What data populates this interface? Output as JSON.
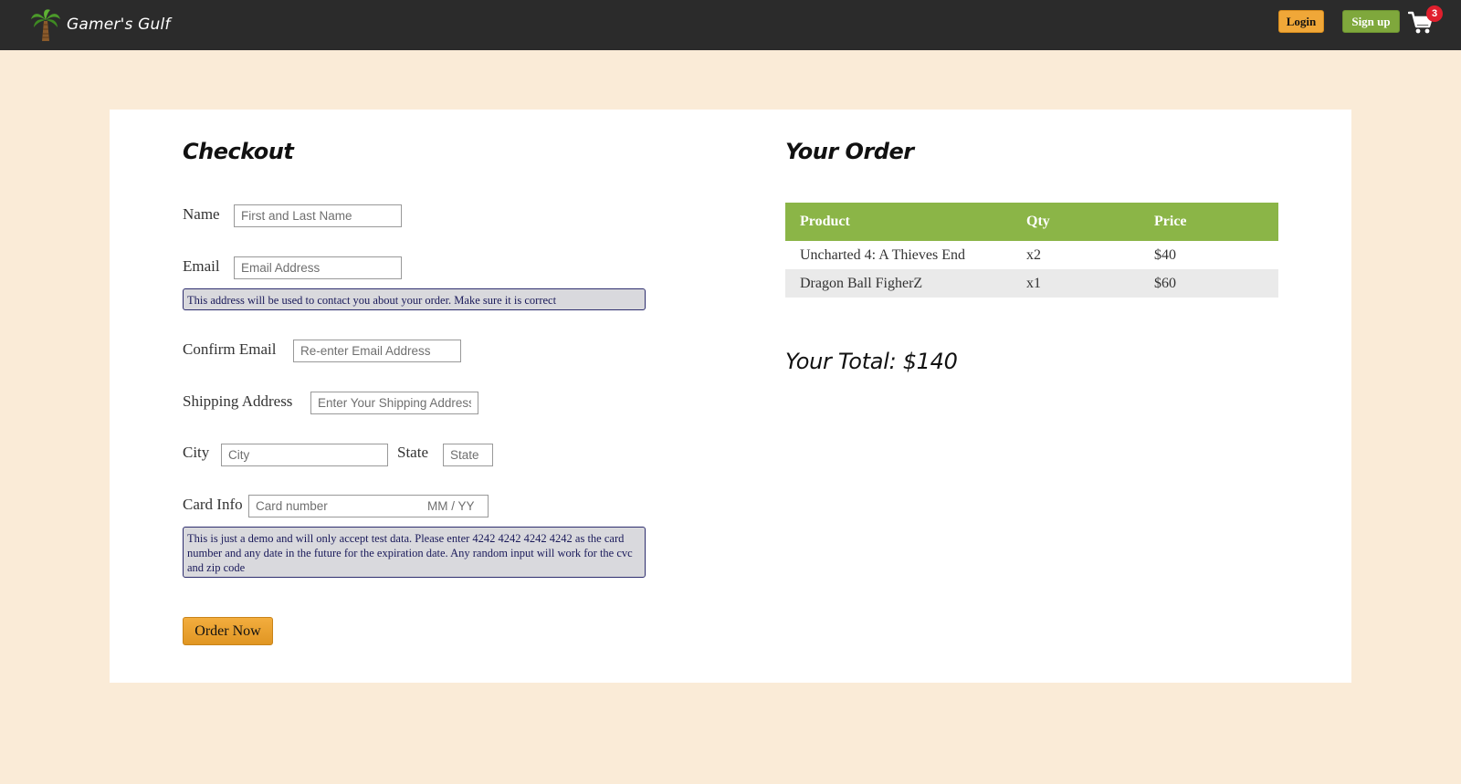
{
  "header": {
    "brand": "Gamer's Gulf",
    "login_label": "Login",
    "signup_label": "Sign up",
    "cart_count": "3"
  },
  "checkout": {
    "title": "Checkout",
    "name_label": "Name",
    "name_placeholder": "First and Last Name",
    "email_label": "Email",
    "email_placeholder": "Email Address",
    "email_notice": "This address will be used to contact you about your order. Make sure it is correct",
    "confirm_email_label": "Confirm Email",
    "confirm_email_placeholder": "Re-enter Email Address",
    "shipping_label": "Shipping Address",
    "shipping_placeholder": "Enter Your Shipping Address",
    "city_label": "City",
    "city_placeholder": "City",
    "state_label": "State",
    "state_placeholder": "State",
    "card_label": "Card Info",
    "card_number_placeholder": "Card number",
    "card_expiry_placeholder": "MM / YY",
    "card_notice": "This is just a demo and will only accept test data. Please enter 4242 4242 4242 4242 as the card number and any date in the future for the expiration date. Any random input will work for the cvc and zip code",
    "order_button": "Order Now"
  },
  "order": {
    "title": "Your Order",
    "columns": [
      "Product",
      "Qty",
      "Price"
    ],
    "rows": [
      {
        "product": "Uncharted 4: A Thieves End",
        "qty": "x2",
        "price": "$40"
      },
      {
        "product": "Dragon Ball FigherZ",
        "qty": "x1",
        "price": "$60"
      }
    ],
    "total": "Your Total: $140"
  },
  "colors": {
    "page_bg": "#faebd7",
    "navbar_bg": "#2b2b2b",
    "login_btn": "#f0a738",
    "signup_btn": "#7fa83c",
    "table_header": "#8bb547",
    "cart_badge": "#e01f2d"
  },
  "icons": {
    "logo": "palm-tree-icon",
    "cart": "shopping-cart-icon"
  }
}
